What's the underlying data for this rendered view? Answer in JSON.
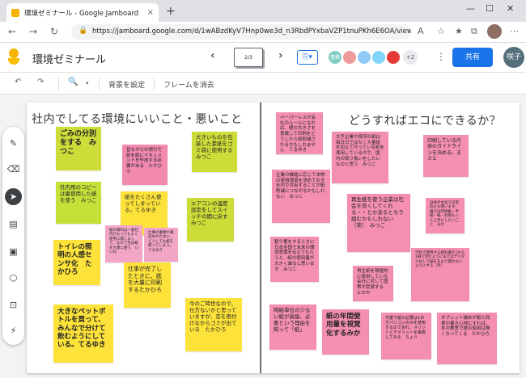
{
  "browser": {
    "tab_title": "環境ゼミナール - Google Jamboard",
    "tab_close": "×",
    "new_tab": "+",
    "url": "https://jamboard.google.com/d/1wABzdKyV7Hnp0we3d_n3RbdPYxbaVZP1tnuPKh6E6OA/viewer?f...",
    "win_min": "—",
    "win_max": "☐",
    "win_close": "✕"
  },
  "app": {
    "doc_title": "環境ゼミナール",
    "frame_indicator": "2/3",
    "prev": "‹",
    "next": "›",
    "collaborators": [
      "悠葉",
      "",
      "",
      "",
      ""
    ],
    "more_collaborators": "+2",
    "share_label": "共有",
    "user_initials": "咲子"
  },
  "toolbar": {
    "set_background": "背景を設定",
    "clear_frame": "フレームを消去"
  },
  "colors": {
    "accent": "#1a73e8",
    "note_lime": "#cddc39",
    "note_yellow": "#fde23a",
    "note_pink": "#f48fb1"
  },
  "tools": [
    "pen-icon",
    "eraser-icon",
    "select-icon",
    "sticky-note-icon",
    "image-icon",
    "circle-icon",
    "text-box-icon",
    "laser-icon"
  ],
  "board": {
    "left_heading": "社内でしてる環境にいいこと・悪いこと",
    "right_heading": "どうすればエコにできるか？",
    "notes": [
      {
        "text": "ごみの分別をする　みつこ"
      },
      {
        "text": "社内用のコピーは裏使用した紙を使う　みつこ"
      },
      {
        "text": "トイレの照明の人感センサ化　たかひろ"
      },
      {
        "text": "大きなペットボトルを買って、みんなで分けて飲むようにしている。てるゆき"
      },
      {
        "text": "昔ながらの慣行で紙を紙にドキュメントを作成する必要がある　たかひろ"
      },
      {
        "text": "紙をたくさん使ってしまっている。てるゆき"
      },
      {
        "text": "紙の資料は一般社内かもってもよく使用に関しまして、なので生は紙を大量に使う　いいね"
      },
      {
        "text": "仕事の書類や箱詰めのために、どうしても紙を使ってしまう。てるゆき"
      },
      {
        "text": "大きいものを包装した素紙をゴミ袋に使用する　みつこ"
      },
      {
        "text": "エアコンの温度設定をしてスイッチの間に戻す　みつこ"
      },
      {
        "text": "仕事が完了したときに、紙を大量に印刷するたかひろ"
      },
      {
        "text": "今のご時世なので、仕方ないかと思っていますが、恋を雨付けなからゴミが出ている　たかひろ"
      },
      {
        "text": "ペーパーレスが会社のルールになれば、極の大きさを意識して印刷をどうしたら紙削減されるかもしれません　てるゆき"
      },
      {
        "text": "企業の機能に応じて本物の使用環境を決めておき社内で共有することが紙削減につながるかもしれない　みつこ"
      },
      {
        "text": "割り箸をするときに日本全国で未来の環境意識を伝えてもらうと、紙の使用量が大きく減ると思います　みつこ"
      },
      {
        "text": "大手企業や役所の紙は毎日日ではなく大量紙を加えて行っている紙を使用しているので、国内の取り扱いをしたいものと思う　みつこ"
      },
      {
        "text": "再生紙を使う企業は社会を良くしてくれる・・とかあるとちり組むかもしれない（笑）　みつこ"
      },
      {
        "text": "再生紙を積極的に使用している会社に対して国策が受賞する　ヒロキ"
      },
      {
        "text": "紙の年間使用量を視覚化するみか"
      },
      {
        "text": "印刷している内容のガイドラインを決める。まさと"
      },
      {
        "text": "日本の文化で日常的にも使います、誰では印刷紙・手紙・紙・封筒もっと上手にしたいこと　みか"
      },
      {
        "text": "学校で使用する教科書を1から1冊で済むようにまたはデジタル化して紙をあまり使わないようにする（笑）"
      },
      {
        "text": "作業で紙の必要は1日ずパソコンのみを使用するのであれ、メリットとデメリットを実施してみる　ちょう"
      },
      {
        "text": "タブレット端末が紙と同様の書き心地にすれば、本の教室で紙の使用は無くなってくる　たかひろ"
      },
      {
        "text": "時給単位の少ない紙が高級、必要という理由を知って「紙」"
      }
    ]
  }
}
